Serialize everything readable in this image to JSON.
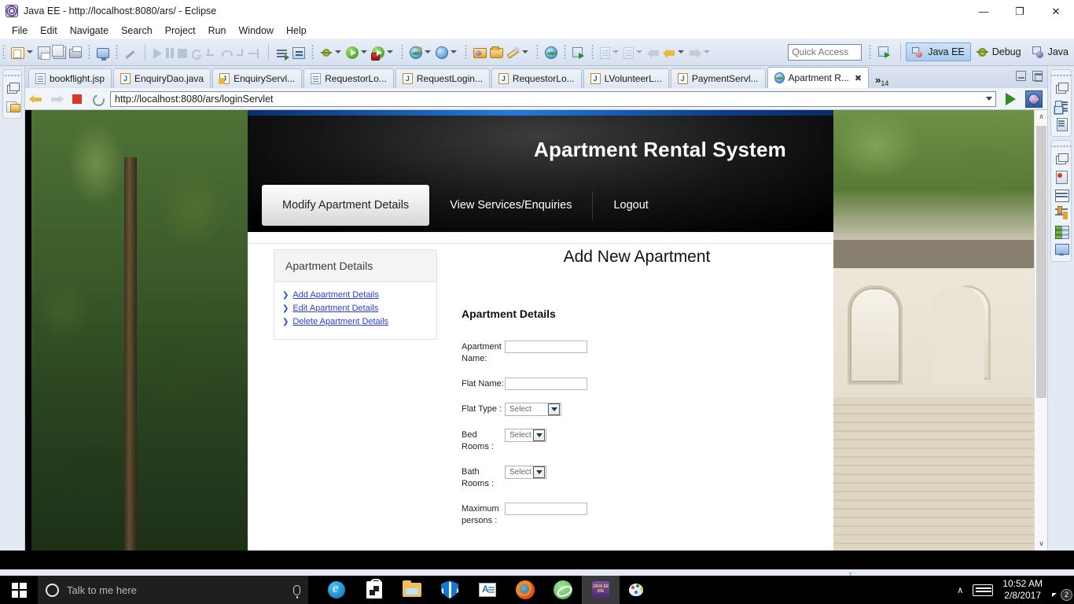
{
  "window": {
    "title": "Java EE - http://localhost:8080/ars/ - Eclipse",
    "minimize": "—",
    "restore": "❐",
    "close": "✕"
  },
  "menu": {
    "items": [
      "File",
      "Edit",
      "Navigate",
      "Search",
      "Project",
      "Run",
      "Window",
      "Help"
    ]
  },
  "toolbar": {
    "quick_access_placeholder": "Quick Access",
    "perspectives": [
      {
        "label": "Java EE",
        "icon": "javaee-perspective-icon",
        "active": true
      },
      {
        "label": "Debug",
        "icon": "debug-perspective-icon",
        "active": false
      },
      {
        "label": "Java",
        "icon": "java-perspective-icon",
        "active": false
      }
    ]
  },
  "editor_tabs": {
    "items": [
      {
        "label": "bookflight.jsp",
        "icon": "jsp-file-icon",
        "active": false
      },
      {
        "label": "EnquiryDao.java",
        "icon": "java-file-icon",
        "active": false
      },
      {
        "label": "EnquiryServl...",
        "icon": "java-warning-file-icon",
        "active": false
      },
      {
        "label": "RequestorLo...",
        "icon": "jsp-file-icon",
        "active": false
      },
      {
        "label": "RequestLogin...",
        "icon": "java-file-icon",
        "active": false
      },
      {
        "label": "RequestorLo...",
        "icon": "java-file-icon",
        "active": false
      },
      {
        "label": "LVolunteerL...",
        "icon": "java-file-icon",
        "active": false
      },
      {
        "label": "PaymentServl...",
        "icon": "java-file-icon",
        "active": false
      },
      {
        "label": "Apartment R...",
        "icon": "web-browser-icon",
        "active": true
      }
    ],
    "overflow_symbol": "»",
    "overflow_count": "14",
    "close_symbol": "✖"
  },
  "browser": {
    "url": "http://localhost:8080/ars/loginServlet"
  },
  "webpage": {
    "brand_title": "Apartment Rental System",
    "nav": [
      {
        "label": "Modify Apartment Details",
        "active": true
      },
      {
        "label": "View Services/Enquiries",
        "active": false
      },
      {
        "label": "Logout",
        "active": false
      }
    ],
    "sidebar": {
      "heading": "Apartment Details",
      "links": [
        "Add Apartment Details",
        "Edit Apartment Details",
        "Delete Apartment Details"
      ],
      "bullet": "❯"
    },
    "page_title": "Add New Apartment",
    "section_title": "Apartment Details",
    "form_fields": [
      {
        "label": "Apartment Name:",
        "type": "text",
        "value": ""
      },
      {
        "label": "Flat Name:",
        "type": "text",
        "value": ""
      },
      {
        "label": "Flat Type :",
        "type": "select",
        "value": "Select"
      },
      {
        "label": "Bed Rooms :",
        "type": "select",
        "value": "Select"
      },
      {
        "label": "Bath Rooms :",
        "type": "select",
        "value": "Select"
      },
      {
        "label": "Maximum persons :",
        "type": "text",
        "value": ""
      }
    ],
    "scroll_up": "∧",
    "scroll_down": "∨"
  },
  "taskbar": {
    "search_placeholder": "Talk to me here",
    "apps": [
      {
        "name": "microsoft-edge"
      },
      {
        "name": "microsoft-store"
      },
      {
        "name": "file-explorer"
      },
      {
        "name": "windows-defender"
      },
      {
        "name": "document-viewer"
      },
      {
        "name": "mozilla-firefox"
      },
      {
        "name": "atom-editor"
      },
      {
        "name": "eclipse-ide"
      },
      {
        "name": "paint"
      }
    ],
    "time": "10:52 AM",
    "date": "2/8/2017",
    "notification_count": "2",
    "tray_caret": "∧"
  }
}
